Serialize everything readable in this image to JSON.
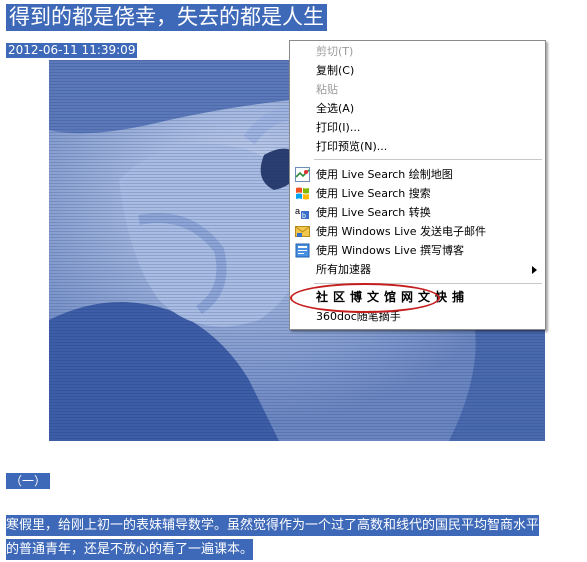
{
  "article": {
    "title": "得到的都是侥幸，失去的都是人生",
    "date": "2012-06-11 11:39:09",
    "section_label": "（一）",
    "paragraph_line1": "寒假里，给刚上初一的表妹辅导数学。虽然觉得作为一个过了高数和线代的国民平均智商水平",
    "paragraph_line2": "的普通青年，还是不放心的看了一遍课本。"
  },
  "context_menu": {
    "cut": "剪切(T)",
    "copy": "复制(C)",
    "paste": "粘贴",
    "select_all": "全选(A)",
    "print": "打印(I)...",
    "print_preview": "打印预览(N)...",
    "live_map": "使用 Live Search 绘制地图",
    "live_search": "使用 Live Search 搜索",
    "live_translate": "使用 Live Search 转换",
    "live_email": "使用 Windows Live 发送电子邮件",
    "live_blog": "使用 Windows Live 撰写博客",
    "accelerators": "所有加速器",
    "grab": "社区博文馆网文快捕",
    "note": "360doc随笔摘手"
  },
  "colors": {
    "selection": "#3e68b8",
    "highlight_oval": "#c41e1e",
    "menu_border": "#8a8a8a",
    "disabled_text": "#9a9a9a"
  },
  "icons": [
    "map-icon",
    "windows-flag-icon",
    "translate-icon",
    "email-icon",
    "blog-icon"
  ]
}
